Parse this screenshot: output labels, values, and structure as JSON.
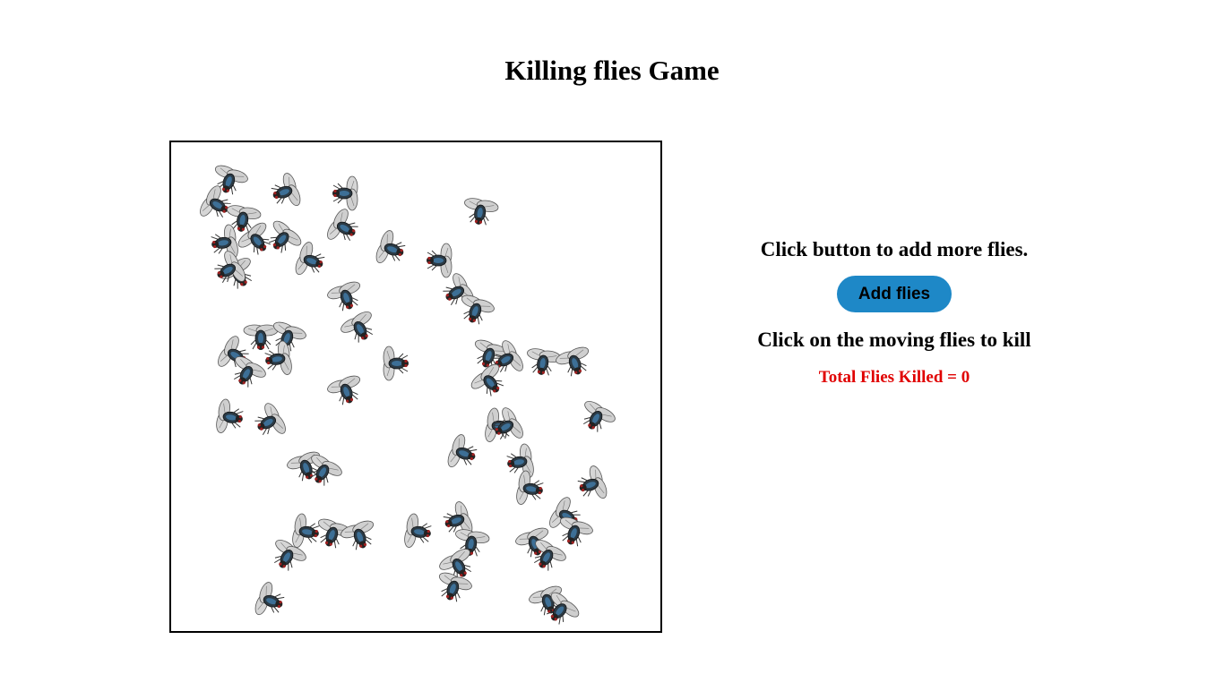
{
  "page_title": "Killing flies Game",
  "instructions": {
    "add_prompt": "Click button to add more flies.",
    "kill_prompt": "Click on the moving flies to kill"
  },
  "add_button_label": "Add flies",
  "score": {
    "label": "Total Flies Killed = ",
    "value": 0
  },
  "colors": {
    "button": "#1e88c7",
    "score_text": "#e00000",
    "border": "#000000"
  },
  "icons": {
    "fly": "fly-icon"
  },
  "fly_count": 58
}
